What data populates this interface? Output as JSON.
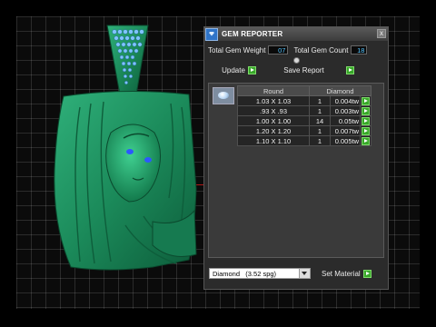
{
  "panel": {
    "title": "GEM REPORTER",
    "close_glyph": "x",
    "total_weight_label": "Total Gem Weight",
    "total_weight_value": "07",
    "total_count_label": "Total Gem Count",
    "total_count_value": "18",
    "update_label": "Update",
    "save_report_label": "Save Report",
    "columns": {
      "shape": "Round",
      "material": "Diamond"
    },
    "rows": [
      {
        "size": "1.03 X 1.03",
        "count": "1",
        "weight": "0.004tw"
      },
      {
        "size": ".93 X .93",
        "count": "1",
        "weight": "0.003tw"
      },
      {
        "size": "1.00 X 1.00",
        "count": "14",
        "weight": "0.05tw"
      },
      {
        "size": "1.20 X 1.20",
        "count": "1",
        "weight": "0.007tw"
      },
      {
        "size": "1.10 X 1.10",
        "count": "1",
        "weight": "0.005tw"
      }
    ],
    "material_select": "Diamond   (3.52 spg)",
    "set_material_label": "Set Material"
  },
  "colors": {
    "model_green": "#1f8a5c",
    "gem_blue": "#5fb1ff",
    "value_text": "#55c6ff",
    "go_green": "#39a82a"
  }
}
